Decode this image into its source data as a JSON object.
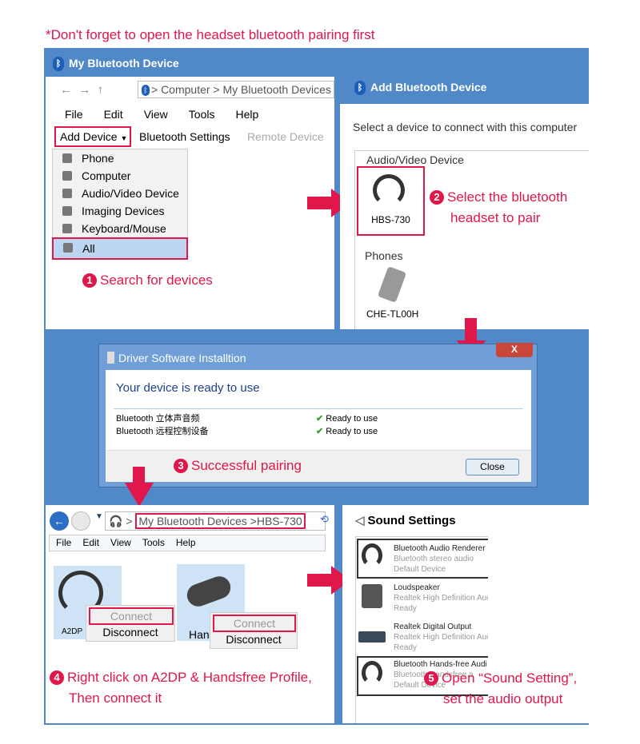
{
  "caption": "*Don't forget to open the headset bluetooth pairing first",
  "panel1": {
    "title": "My Bluetooth Device",
    "address": "> Computer > My Bluetooth Devices",
    "menu": [
      "File",
      "Edit",
      "View",
      "Tools",
      "Help"
    ],
    "toolbar": {
      "add_device": "Add Device",
      "bluetooth_settings": "Bluetooth Settings",
      "remote_device": "Remote Device"
    },
    "dropdown": [
      "Phone",
      "Computer",
      "Audio/Video Device",
      "Imaging Devices",
      "Keyboard/Mouse",
      "All"
    ],
    "step": "1",
    "step_text": "Search for devices"
  },
  "panel2": {
    "title": "Add Bluetooth Device",
    "prompt": "Select a device to connect with this computer",
    "group1": "Audio/Video Device",
    "device1": "HBS-730",
    "group2": "Phones",
    "device2": "CHE-TL00H",
    "step": "2",
    "step_text_1": "Select the bluetooth",
    "step_text_2": "headset to pair"
  },
  "dialog": {
    "title": "Driver Software Installtion",
    "heading": "Your device is ready to use",
    "rows": [
      {
        "name": "Bluetooth 立体声音频",
        "status": "Ready to use"
      },
      {
        "name": "Bluetooth 远程控制设备",
        "status": "Ready to use"
      }
    ],
    "close": "Close",
    "close_x": "X",
    "step": "3",
    "step_text": "Successful pairing"
  },
  "panel4": {
    "address": "My Bluetooth Devices >HBS-730",
    "menu": [
      "File",
      "Edit",
      "View",
      "Tools",
      "Help"
    ],
    "devices": [
      {
        "label": "A2DP",
        "connect": "Connect",
        "disconnect": "Disconnect"
      },
      {
        "label": "Han",
        "connect": "Connect",
        "disconnect": "Disconnect"
      }
    ],
    "step": "4",
    "step_text_1": "Right click on A2DP & Handsfree Profile,",
    "step_text_2": "Then connect it"
  },
  "panel5": {
    "title": "Sound Settings",
    "devices": [
      {
        "name": "Bluetooth Audio Renderer",
        "desc": "Bluetooth stereo audio",
        "status": "Default Device"
      },
      {
        "name": "Loudspeaker",
        "desc": "Realtek High Definition Auc",
        "status": "Ready"
      },
      {
        "name": "Realtek Digital Output",
        "desc": "Realtek High Definition Auc",
        "status": "Ready"
      },
      {
        "name": "Bluetooth Hands-free Audi",
        "desc": "Bluetooth Handsfree a",
        "status": "Default Device"
      }
    ],
    "step": "5",
    "step_text_1": "Open “Sound Setting”,",
    "step_text_2": "set the audio output"
  },
  "colors": {
    "accent": "#e0174a",
    "frame": "#5189c8"
  }
}
